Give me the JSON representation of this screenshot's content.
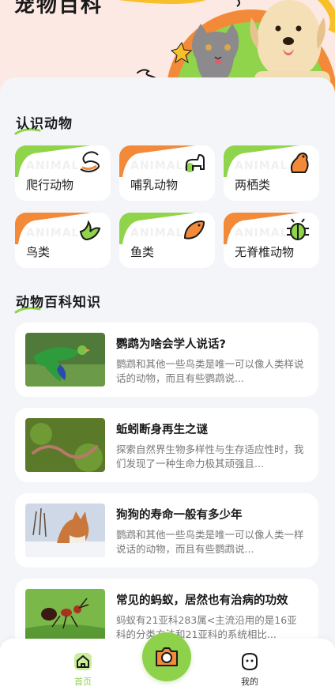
{
  "hero": {
    "title": "宠物百科",
    "accent_green": "#8fd44a",
    "accent_orange": "#f28a3a"
  },
  "sections": {
    "categories_title": "认识动物",
    "encyclopedia_title": "动物百科知识"
  },
  "categories": [
    {
      "label": "爬行动物",
      "watermark": "ANIMAL",
      "icon": "snake-icon",
      "accent": "green"
    },
    {
      "label": "哺乳动物",
      "watermark": "ANIMAL",
      "icon": "dog-icon",
      "accent": "orange"
    },
    {
      "label": "两栖类",
      "watermark": "ANIMAL",
      "icon": "frog-icon",
      "accent": "green"
    },
    {
      "label": "鸟类",
      "watermark": "ANIMAL",
      "icon": "bird-icon",
      "accent": "orange"
    },
    {
      "label": "鱼类",
      "watermark": "ANIMAL",
      "icon": "fish-icon",
      "accent": "green"
    },
    {
      "label": "无脊椎动物",
      "watermark": "ANIMAL",
      "icon": "bug-icon",
      "accent": "orange"
    }
  ],
  "articles": [
    {
      "title": "鹦鹉为啥会学人说话?",
      "desc": "鹦鹉和其他一些鸟类是唯一可以像人类样说话的动物，而且有些鹦鹉说..."
    },
    {
      "title": "蚯蚓断身再生之谜",
      "desc": "探索自然界生物多样性与生存适应性时，我们发现了一种生命力极其顽强且..."
    },
    {
      "title": "狗狗的寿命一般有多少年",
      "desc": "鹦鹉和其他一些鸟类是唯一可以像人类一样说话的动物，而且有些鹦鹉说..."
    },
    {
      "title": "常见的蚂蚁，居然也有治病的功效",
      "desc": "蚂蚁有21亚科283属<主流沿用的是16亚科的分类方法和21亚科的系统相比..."
    }
  ],
  "tabbar": {
    "home_label": "首页",
    "mine_label": "我的",
    "active_color": "#8ed14b"
  }
}
